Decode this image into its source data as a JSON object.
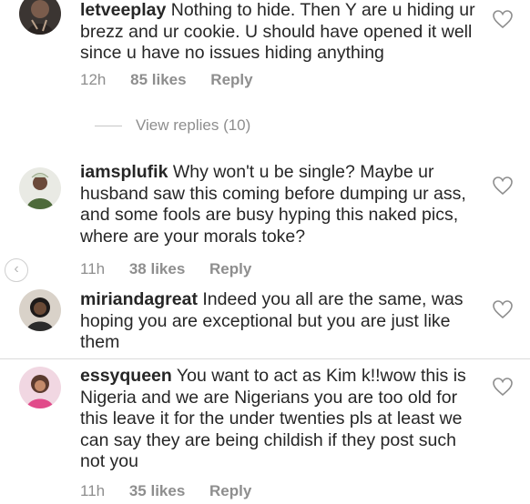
{
  "comments": [
    {
      "username": "letveeplay",
      "text": "Nothing to hide. Then Y are u hiding ur brezz and ur cookie. U should have opened it well since u have no issues hiding anything",
      "time": "12h",
      "likes": "85 likes",
      "reply": "Reply"
    },
    {
      "username": "iamsplufik",
      "text": "Why won't u be single? Maybe ur husband saw this coming before dumping ur ass, and some fools are busy hyping this naked pics, where are your morals toke?",
      "time": "11h",
      "likes": "38 likes",
      "reply": "Reply"
    },
    {
      "username": "miriandagreat",
      "text": "Indeed you all are the same, was hoping you are exceptional but you are just like them"
    },
    {
      "username": "essyqueen",
      "text": "You want to act as Kim k!!wow this is Nigeria and we are Nigerians you are too old for this leave it for the under twenties pls at least we can say they are being childish if they post such not you",
      "time": "11h",
      "likes": "35 likes",
      "reply": "Reply"
    }
  ],
  "view_replies": "View replies (10)",
  "icons": {
    "like": "heart-outline-icon",
    "back": "chevron-left-icon"
  },
  "colors": {
    "text": "#262626",
    "meta": "#8e8e8e",
    "divider": "#dbdbdb"
  }
}
